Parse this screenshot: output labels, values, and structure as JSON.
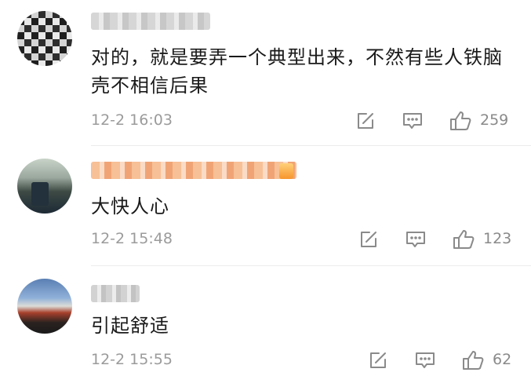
{
  "comments": [
    {
      "text": "对的，就是要弄一个典型出来，不然有些人铁脑壳不相信后果",
      "time": "12-2 16:03",
      "likes": "259"
    },
    {
      "text": "大快人心",
      "time": "12-2 15:48",
      "likes": "123"
    },
    {
      "text": "引起舒适",
      "time": "12-2 15:55",
      "likes": "62"
    }
  ],
  "icons": {
    "repost": "edit-share-icon",
    "comment": "comment-bubble-icon",
    "like": "thumbs-up-icon"
  },
  "colors": {
    "text": "#1a1a1a",
    "meta": "#9b9b9b",
    "icon": "#8a8a8a",
    "divider": "#ececec"
  }
}
